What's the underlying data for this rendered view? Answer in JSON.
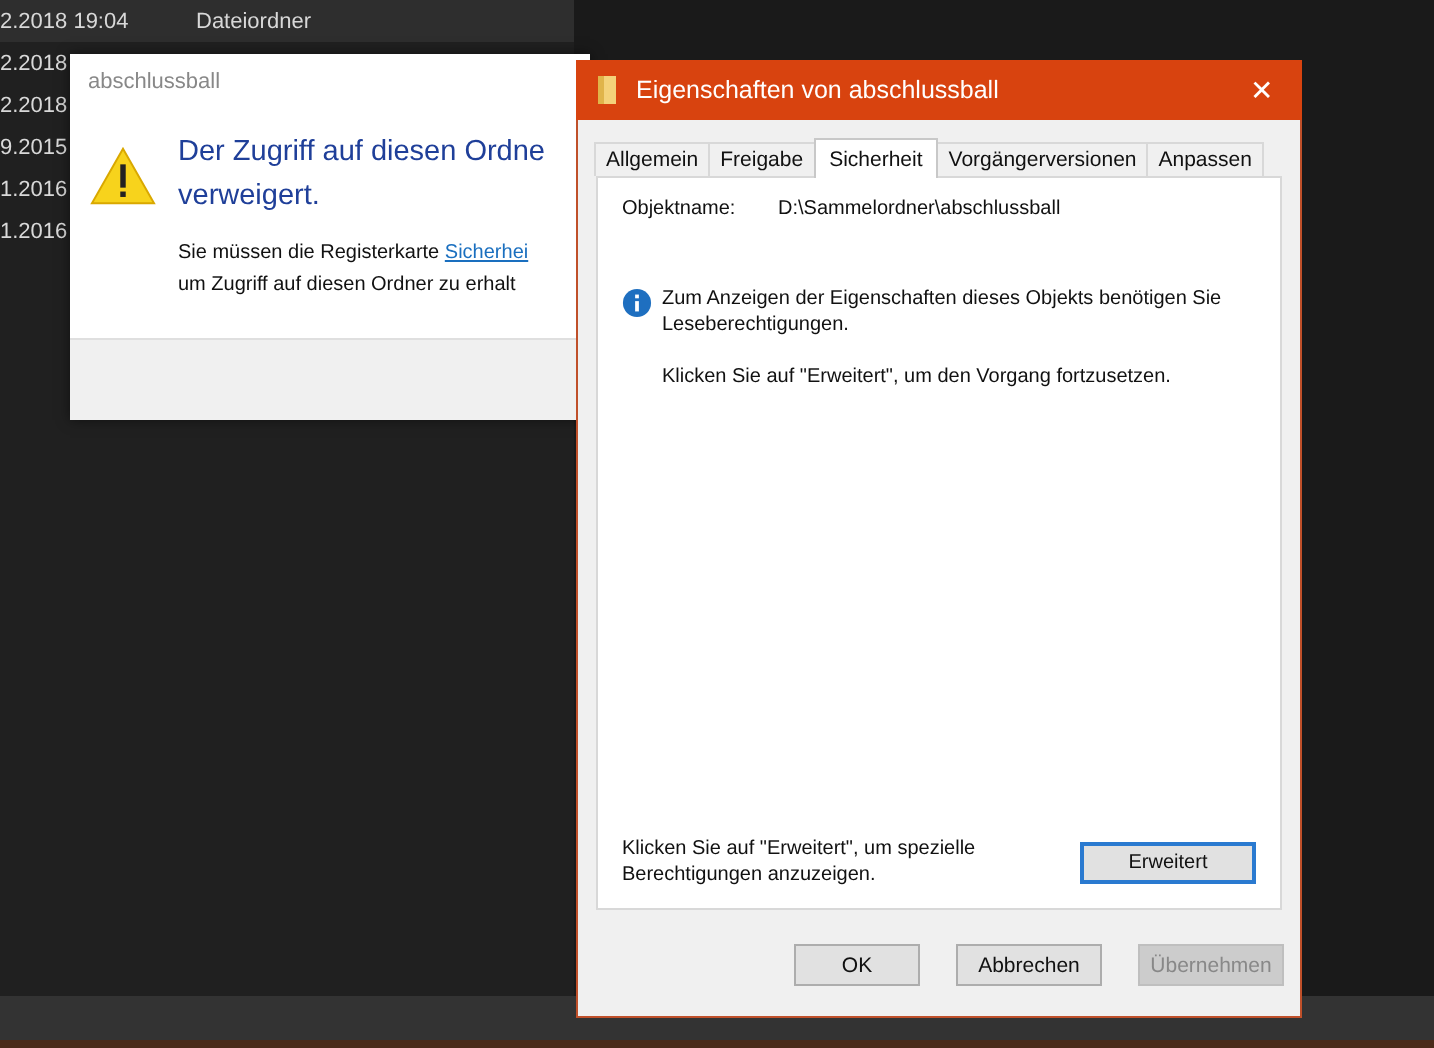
{
  "explorer": {
    "rows": [
      {
        "date": "2.2018 19:04",
        "type": "Dateiordner",
        "selected": true
      },
      {
        "date": "2.2018",
        "selected": false
      },
      {
        "date": "2.2018",
        "selected": false
      },
      {
        "date": "9.2015",
        "selected": false
      },
      {
        "date": "1.2016",
        "selected": false
      },
      {
        "date": "1.2016",
        "selected": false
      }
    ]
  },
  "error_dialog": {
    "title": "abschlussball",
    "heading": "Der Zugriff auf diesen Ordne verweigert.",
    "message_start": "Sie müssen die Registerkarte",
    "link": "Sicherhei",
    "message_end": "um Zugriff auf diesen Ordner zu erhalt"
  },
  "properties_window": {
    "title": "Eigenschaften von abschlussball",
    "close": "✕",
    "tabs": [
      {
        "label": "Allgemein",
        "selected": false
      },
      {
        "label": "Freigabe",
        "selected": false
      },
      {
        "label": "Sicherheit",
        "selected": true
      },
      {
        "label": "Vorgängerversionen",
        "selected": false
      },
      {
        "label": "Anpassen",
        "selected": false
      }
    ],
    "object_label": "Objektname:",
    "object_value": "D:\\Sammelordner\\abschlussball",
    "info_text": "Zum Anzeigen der Eigenschaften dieses Objekts benötigen Sie Leseberechtigungen.",
    "continue_text": "Klicken Sie auf \"Erweitert\", um den Vorgang fortzusetzen.",
    "advanced_text": "Klicken Sie auf \"Erweitert\", um spezielle Berechtigungen anzuzeigen.",
    "advanced_button": "Erweitert",
    "buttons": [
      {
        "label": "OK",
        "disabled": false
      },
      {
        "label": "Abbrechen",
        "disabled": false
      },
      {
        "label": "Übernehmen",
        "disabled": true
      }
    ]
  }
}
